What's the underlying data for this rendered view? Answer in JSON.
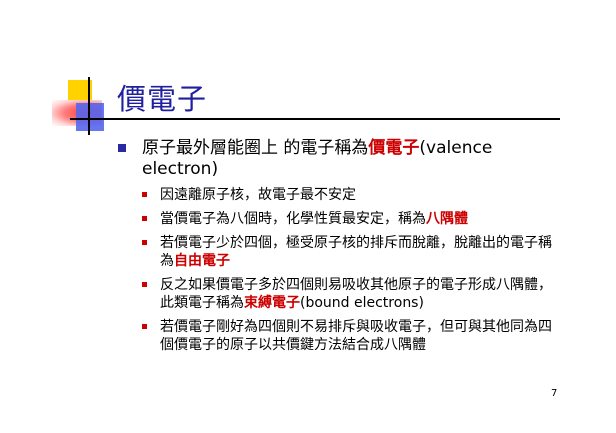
{
  "title": "價電子",
  "bullets": {
    "main": {
      "pre": "原子最外層能圈上 的電子稱為",
      "em": "價電子",
      "post": "(valence electron)"
    },
    "sub": [
      {
        "pre": "因遠離原子核，故電子最不安定",
        "em": "",
        "post": ""
      },
      {
        "pre": "當價電子為八個時，化學性質最安定，稱為",
        "em": "八隅體",
        "post": ""
      },
      {
        "pre": "若價電子少於四個，極受原子核的排斥而脫離，脫離出的電子稱為",
        "em": "自由電子",
        "post": ""
      },
      {
        "pre": "反之如果價電子多於四個則易吸收其他原子的電子形成八隅體，此類電子稱為",
        "em": "束縛電子",
        "post": "(bound electrons)"
      },
      {
        "pre": "若價電子剛好為四個則不易排斥與吸收電子，但可與其他同為四個價電子的原子以共價鍵方法結合成八隅體",
        "em": "",
        "post": ""
      }
    ]
  },
  "page_number": "7",
  "colors": {
    "title": "#1f1fa0",
    "emphasis": "#cc0000",
    "bullet_main": "#2a2aa0",
    "bullet_sub": "#cc0000"
  }
}
